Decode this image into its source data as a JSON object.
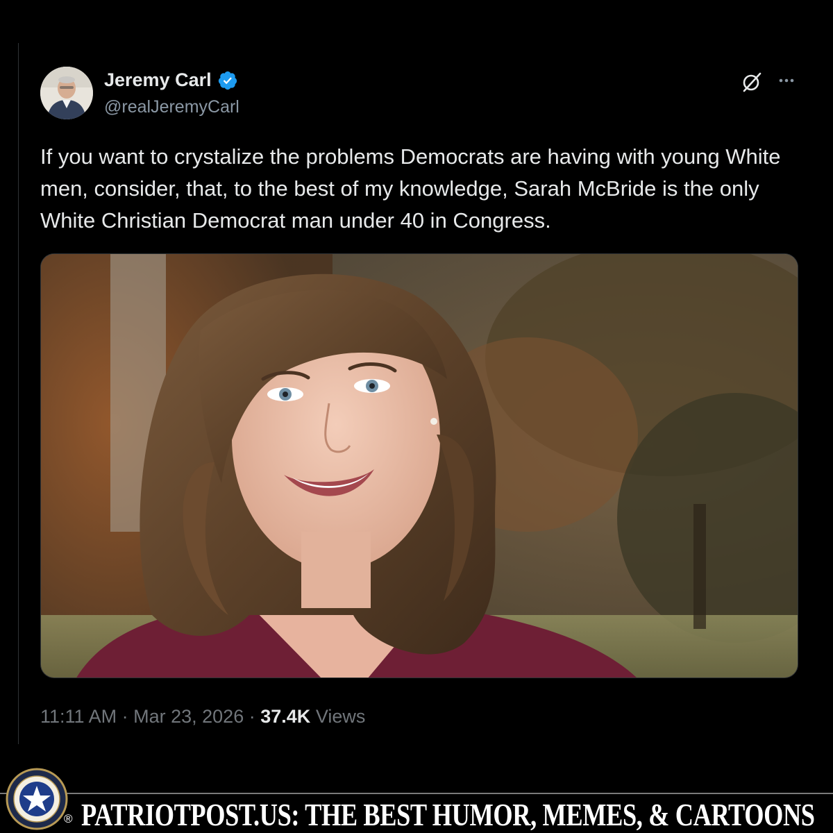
{
  "post": {
    "author_name": "Jeremy Carl",
    "author_handle": "@realJeremyCarl",
    "text": "If you want to crystalize the problems Democrats are having with young White men, consider, that, to the best of my knowledge, Sarah McBride is the only White Christian Democrat man under 40 in Congress.",
    "time": "11:11 AM",
    "date": "Mar 23, 2026",
    "views_count": "37.4K",
    "views_label": "Views",
    "separator": "·"
  },
  "icons": {
    "verified": "verified-badge-icon",
    "grok": "grok-icon",
    "more": "more-options-icon"
  },
  "banner": {
    "text": "PATRIOTPOST.US: THE BEST HUMOR, MEMES, & CARTOONS",
    "registered_mark": "®"
  },
  "colors": {
    "background": "#000000",
    "primary_text": "#e7e9ea",
    "secondary_text": "#71767b",
    "verified_blue": "#1d9bf0",
    "border": "#2f3336"
  }
}
